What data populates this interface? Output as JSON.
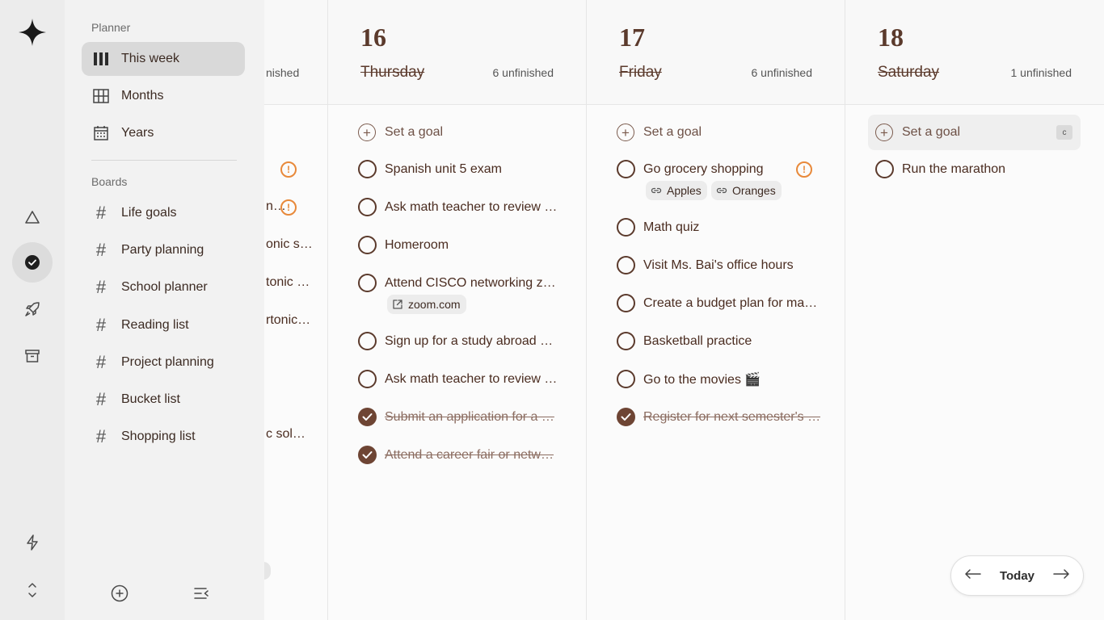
{
  "sidebar": {
    "planner_label": "Planner",
    "boards_label": "Boards",
    "planner_items": [
      {
        "label": "This week",
        "icon": "columns-icon",
        "active": true
      },
      {
        "label": "Months",
        "icon": "grid-icon"
      },
      {
        "label": "Years",
        "icon": "calendar-icon"
      }
    ],
    "boards": [
      {
        "label": "Life goals"
      },
      {
        "label": "Party planning"
      },
      {
        "label": "School planner"
      },
      {
        "label": "Reading list"
      },
      {
        "label": "Project planning"
      },
      {
        "label": "Bucket list"
      },
      {
        "label": "Shopping list"
      }
    ]
  },
  "partial_column": {
    "unfinished": "nished",
    "tasks": [
      "n…",
      "onic s…",
      "tonic …",
      "rtonic…",
      "c sol…"
    ]
  },
  "columns": [
    {
      "day_num": "16",
      "day_name": "Thursday",
      "unfinished": "6 unfinished",
      "set_goal": "Set a goal",
      "tasks": [
        {
          "text": "Spanish unit 5 exam",
          "done": false
        },
        {
          "text": "Ask math teacher to review …",
          "done": false
        },
        {
          "text": "Homeroom",
          "done": false
        },
        {
          "text": "Attend CISCO networking z…",
          "done": false,
          "chip": "zoom.com"
        },
        {
          "text": "Sign up for a study abroad …",
          "done": false
        },
        {
          "text": "Ask math teacher to review …",
          "done": false
        },
        {
          "text": "Submit an application for a …",
          "done": true
        },
        {
          "text": "Attend a career fair or netw…",
          "done": true
        }
      ]
    },
    {
      "day_num": "17",
      "day_name": "Friday",
      "unfinished": "6 unfinished",
      "set_goal": "Set a goal",
      "tasks": [
        {
          "text": "Go grocery shopping",
          "done": false,
          "chips": [
            "Apples",
            "Oranges"
          ],
          "warning": true
        },
        {
          "text": "Math quiz",
          "done": false
        },
        {
          "text": "Visit Ms. Bai's office hours",
          "done": false
        },
        {
          "text": "Create a budget plan for ma…",
          "done": false
        },
        {
          "text": "Basketball practice",
          "done": false
        },
        {
          "text": "Go to the movies 🎬",
          "done": false
        },
        {
          "text": "Register for next semester's …",
          "done": true
        }
      ]
    },
    {
      "day_num": "18",
      "day_name": "Saturday",
      "unfinished": "1 unfinished",
      "set_goal": "Set a goal",
      "shortcut": "c",
      "tasks": [
        {
          "text": "Run the marathon",
          "done": false
        }
      ]
    }
  ],
  "nav": {
    "today_label": "Today"
  },
  "colors": {
    "accent": "#6e4534",
    "warning": "#e8893a"
  }
}
